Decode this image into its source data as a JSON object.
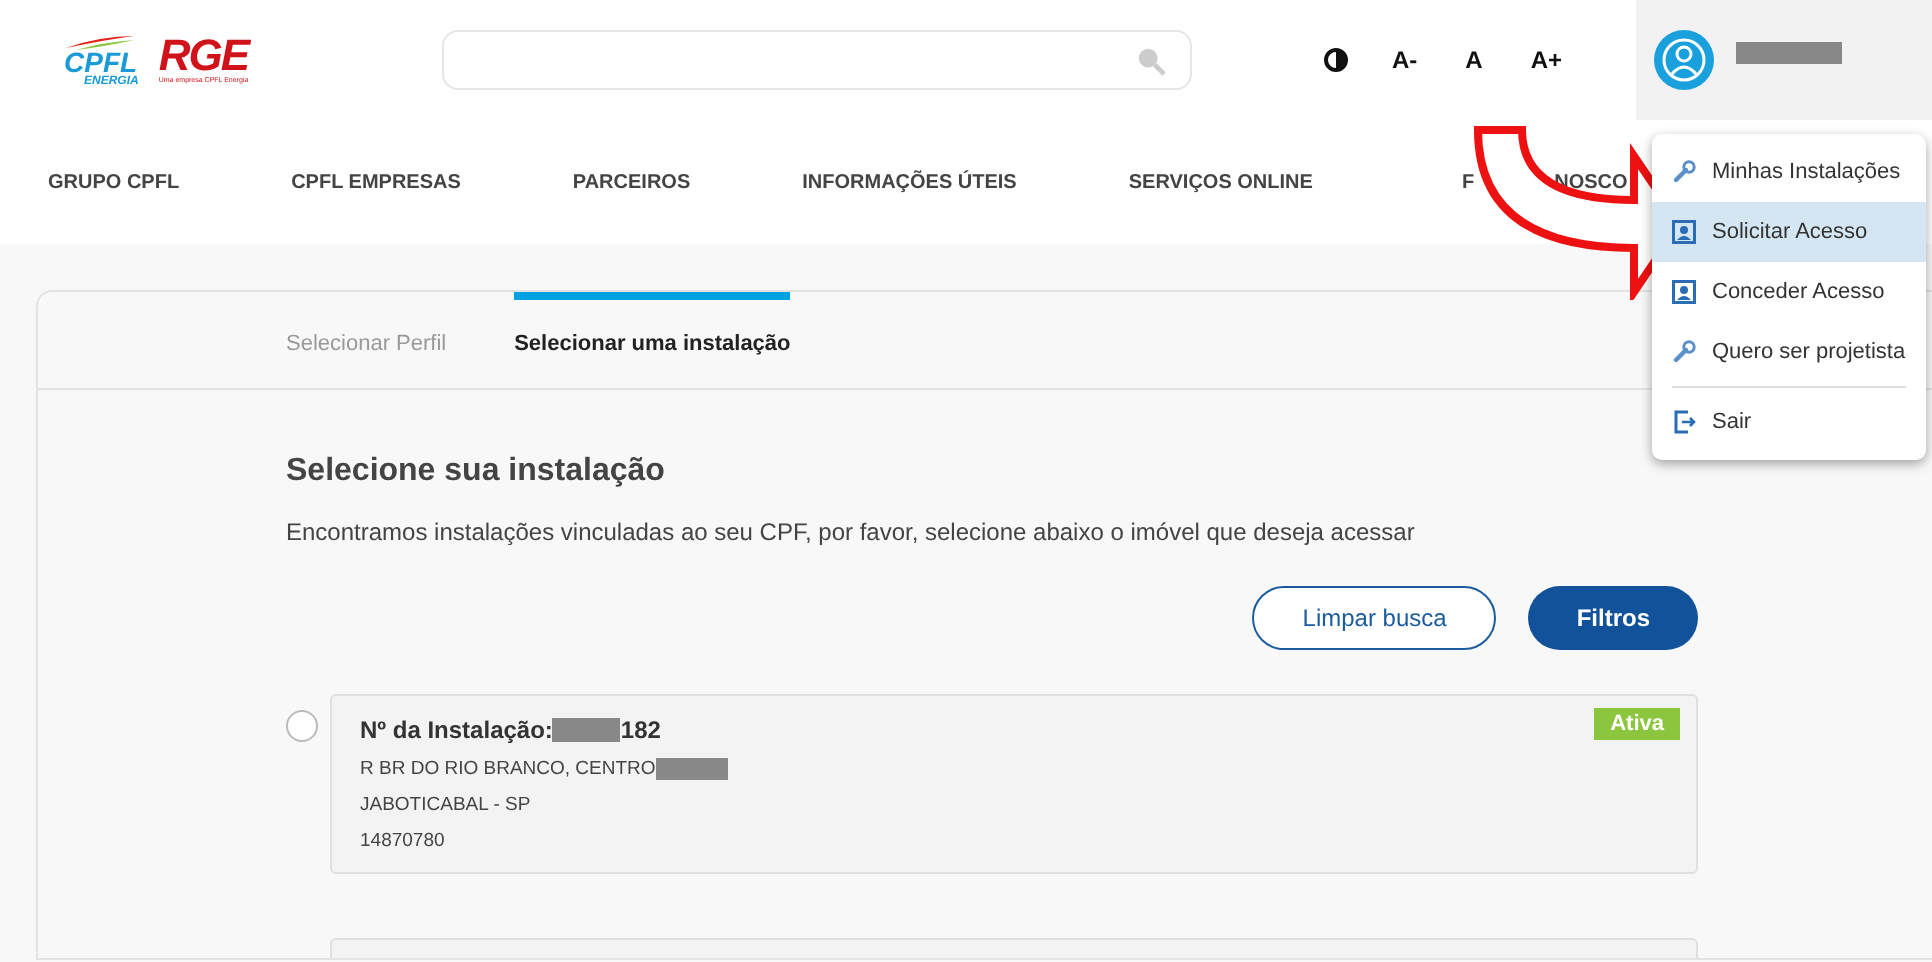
{
  "header": {
    "logos": [
      {
        "kind": "cpfl",
        "name": "CPFL",
        "sub": "ENERGIA"
      },
      {
        "kind": "rge",
        "name": "RGE",
        "sub": "Uma empresa CPFL Energia"
      }
    ],
    "accessibility": [
      {
        "kind": "contrast"
      },
      {
        "kind": "text",
        "label": "A-"
      },
      {
        "kind": "text",
        "label": "A"
      },
      {
        "kind": "text",
        "label": "A+"
      }
    ],
    "user": {
      "name_hidden": true
    }
  },
  "nav": [
    {
      "parts": [
        "GRUPO CPFL"
      ]
    },
    {
      "parts": [
        "CPFL EMPRESAS"
      ]
    },
    {
      "parts": [
        "PARCEIROS"
      ]
    },
    {
      "parts": [
        "INFORMAÇÕES ÚTEIS"
      ]
    },
    {
      "parts": [
        "SERVIÇOS ONLINE"
      ]
    },
    {
      "parts": [
        "F",
        "NOSCO"
      ]
    }
  ],
  "user_menu": [
    {
      "kind": "wrench",
      "label": "Minhas Instalações",
      "selected": false,
      "divider_before": false
    },
    {
      "kind": "person",
      "label": "Solicitar Acesso",
      "selected": true,
      "divider_before": false
    },
    {
      "kind": "person",
      "label": "Conceder Acesso",
      "selected": false,
      "divider_before": false
    },
    {
      "kind": "wrench",
      "label": "Quero ser projetista",
      "selected": false,
      "divider_before": false
    },
    {
      "kind": "exit",
      "label": "Sair",
      "selected": false,
      "divider_before": true
    }
  ],
  "annotation": {
    "kind": "curved-arrow"
  },
  "steps": [
    {
      "label": "Selecionar Perfil",
      "selected": false
    },
    {
      "label": "Selecionar uma instalação",
      "selected": true
    }
  ],
  "heading": "Selecione sua instalação",
  "intro": "Encontramos instalações vinculadas ao seu CPF, por favor, selecione abaixo o imóvel que deseja acessar",
  "buttons": [
    {
      "kind": "outline",
      "label": "Limpar busca"
    },
    {
      "kind": "filled",
      "label": "Filtros"
    }
  ],
  "installations": [
    {
      "selected": false,
      "label": "Nº da Instalação:",
      "number_hidden": true,
      "number_tail": "182",
      "address": "R BR DO RIO BRANCO, CENTRO",
      "address_hidden_tail": true,
      "city": "JABOTICABAL - SP",
      "code": "14870780",
      "status": "Ativa",
      "color": "#8cc63f"
    }
  ]
}
